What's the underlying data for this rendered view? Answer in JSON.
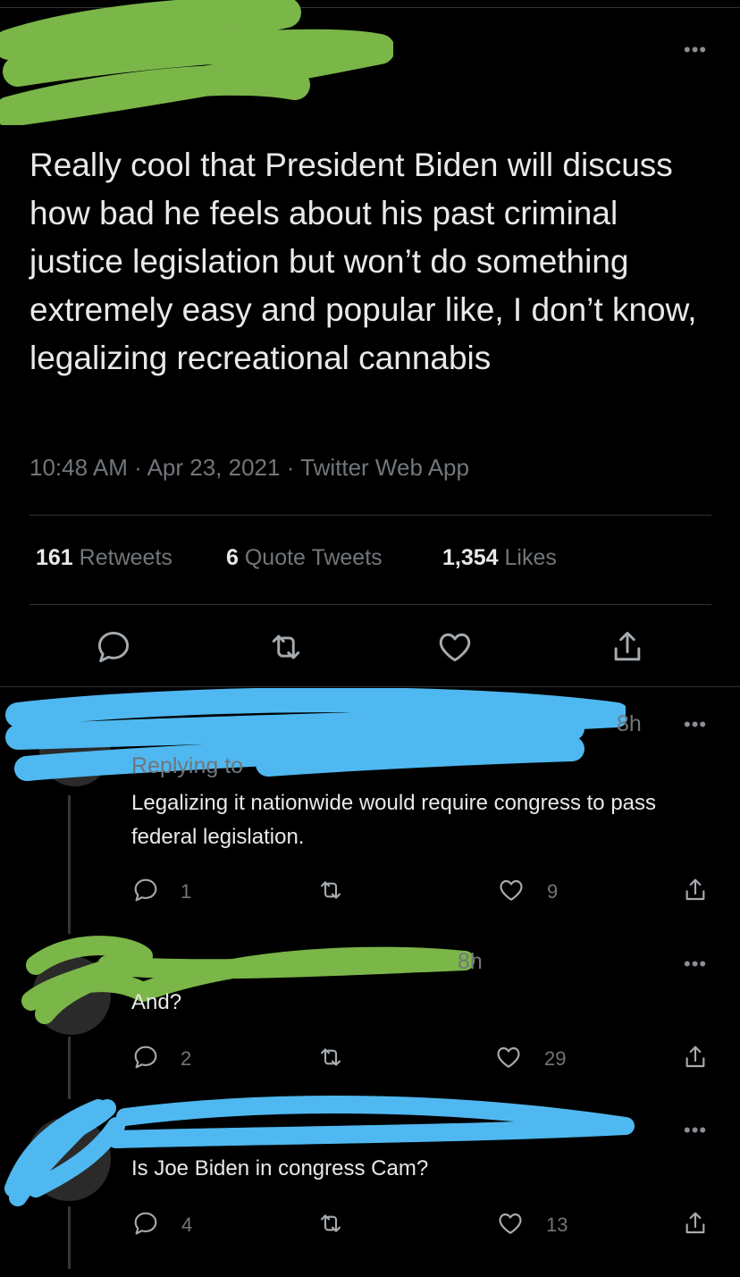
{
  "tweet": {
    "text": "Really cool that President Biden will discuss how bad he feels about his past criminal justice legislation but won’t do something extremely easy and popular like, I don’t know, legalizing recreational cannabis",
    "time": "10:48 AM",
    "date": "Apr 23, 2021",
    "source": "Twitter Web App",
    "separator": "·",
    "more_label": "•••",
    "stats": {
      "retweets_count": "161",
      "retweets_label": "Retweets",
      "quotes_count": "6",
      "quotes_label": "Quote Tweets",
      "likes_count": "1,354",
      "likes_label": "Likes"
    },
    "actions": [
      "reply-icon",
      "retweet-icon",
      "like-icon",
      "share-icon"
    ]
  },
  "replies": [
    {
      "time": "8h",
      "replying_to": "Replying to",
      "text": "Legalizing it nationwide would require congress to pass federal legislation.",
      "reply_count": "1",
      "like_count": "9",
      "more_label": "•••"
    },
    {
      "time": "8h",
      "text": "And?",
      "reply_count": "2",
      "like_count": "29",
      "more_label": "•••"
    },
    {
      "text": "Is Joe Biden in congress Cam?",
      "reply_count": "4",
      "like_count": "13",
      "more_label": "•••"
    }
  ],
  "colors": {
    "background": "#000000",
    "text": "#e7e9ea",
    "secondary": "#71767b",
    "redaction_green": "#7ab648",
    "redaction_blue": "#4fb8f0"
  }
}
